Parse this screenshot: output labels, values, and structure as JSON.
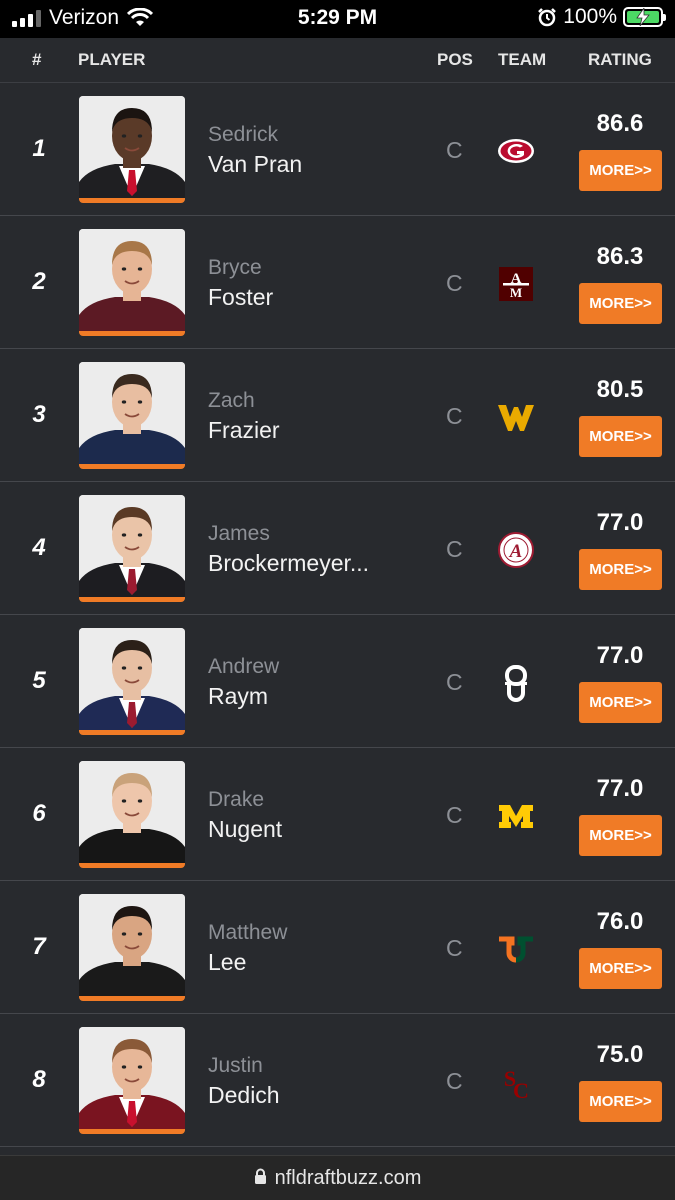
{
  "status": {
    "carrier": "Verizon",
    "time": "5:29 PM",
    "battery": "100%"
  },
  "header": {
    "rank": "#",
    "player": "PLAYER",
    "pos": "POS",
    "team": "TEAM",
    "rating": "RATING"
  },
  "players": [
    {
      "rank": "1",
      "first": "Sedrick",
      "last": "Van Pran",
      "pos": "C",
      "team_logo": "georgia-logo",
      "rating": "86.6",
      "more": "MORE>>",
      "skin": "#5a3a28",
      "hair": "#1b1411",
      "suit": "#1f1f22",
      "tie": "#c8102e"
    },
    {
      "rank": "2",
      "first": "Bryce",
      "last": "Foster",
      "pos": "C",
      "team_logo": "texas-am-logo",
      "rating": "86.3",
      "more": "MORE>>",
      "skin": "#e6b595",
      "hair": "#a87748",
      "suit": "#5c1a24",
      "tie": ""
    },
    {
      "rank": "3",
      "first": "Zach",
      "last": "Frazier",
      "pos": "C",
      "team_logo": "west-virginia-logo",
      "rating": "80.5",
      "more": "MORE>>",
      "skin": "#e8bea1",
      "hair": "#3a2a1f",
      "suit": "#1c2a4d",
      "tie": ""
    },
    {
      "rank": "4",
      "first": "James",
      "last": "Brockermeyer...",
      "pos": "C",
      "team_logo": "alabama-logo",
      "rating": "77.0",
      "more": "MORE>>",
      "skin": "#eac4a8",
      "hair": "#5a3a25",
      "suit": "#1d1d21",
      "tie": "#9b1b30"
    },
    {
      "rank": "5",
      "first": "Andrew",
      "last": "Raym",
      "pos": "C",
      "team_logo": "oklahoma-logo",
      "rating": "77.0",
      "more": "MORE>>",
      "skin": "#e7bfa3",
      "hair": "#2b2018",
      "suit": "#1f2a55",
      "tie": "#9b1b30"
    },
    {
      "rank": "6",
      "first": "Drake",
      "last": "Nugent",
      "pos": "C",
      "team_logo": "michigan-logo",
      "rating": "77.0",
      "more": "MORE>>",
      "skin": "#eec6ab",
      "hair": "#c9a27a",
      "suit": "#161616",
      "tie": ""
    },
    {
      "rank": "7",
      "first": "Matthew",
      "last": "Lee",
      "pos": "C",
      "team_logo": "miami-logo",
      "rating": "76.0",
      "more": "MORE>>",
      "skin": "#d9a582",
      "hair": "#1e1612",
      "suit": "#1a1a1a",
      "tie": ""
    },
    {
      "rank": "8",
      "first": "Justin",
      "last": "Dedich",
      "pos": "C",
      "team_logo": "usc-logo",
      "rating": "75.0",
      "more": "MORE>>",
      "skin": "#e7b798",
      "hair": "#8a5a38",
      "suit": "#7a1420",
      "tie": "#c8102e"
    }
  ],
  "url": "nfldraftbuzz.com",
  "colors": {
    "accent": "#f07b26",
    "background": "#282a2e",
    "georgia_red": "#ba0c2f",
    "texas_am_maroon": "#500000",
    "wvu_gold": "#eaaa00",
    "alabama_crimson": "#9e1b32",
    "michigan_maize": "#ffcb05",
    "miami_orange": "#f47321",
    "miami_green": "#005030",
    "usc_cardinal": "#990000"
  }
}
